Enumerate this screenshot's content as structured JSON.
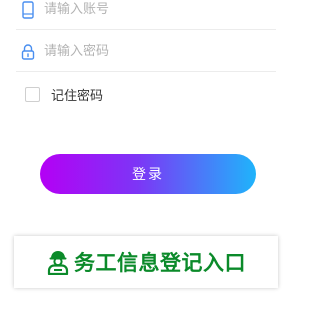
{
  "login_form": {
    "phone": {
      "icon": "phone-icon",
      "placeholder": "请输入账号",
      "value": ""
    },
    "password": {
      "icon": "lock-icon",
      "placeholder": "请输入密码",
      "value": ""
    },
    "remember": {
      "label": "记住密码",
      "checked": false
    },
    "submit": {
      "label": "登录"
    }
  },
  "entry": {
    "icon": "worker-icon",
    "label": "务工信息登记入口"
  },
  "colors": {
    "gradient_start": "#b400f5",
    "gradient_end": "#1fb4fb",
    "icon_blue": "#4a8ff0",
    "entry_green": "#0b8a2a"
  }
}
